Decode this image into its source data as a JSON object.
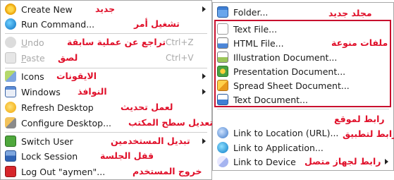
{
  "main_menu": {
    "items": [
      {
        "label": "Create New",
        "annotation": "جديد",
        "icon": "new-star-icon"
      },
      {
        "label": "Run Command...",
        "annotation": "تشغيل أمر",
        "icon": "run-command-icon"
      },
      {
        "label_u": "U",
        "label_rest": "ndo",
        "annotation": "تراجع عن عملية سابقة",
        "shortcut": "Ctrl+Z",
        "icon": "undo-icon"
      },
      {
        "label_u": "P",
        "label_rest": "aste",
        "annotation": "لصق",
        "shortcut": "Ctrl+V",
        "icon": "paste-icon"
      },
      {
        "label": "Icons",
        "annotation": "الايقونات",
        "icon": "icons-icon"
      },
      {
        "label": "Windows",
        "annotation": "النوافذ",
        "icon": "windows-icon"
      },
      {
        "label": "Refresh Desktop",
        "annotation": "لعمل تحديث",
        "icon": "refresh-icon"
      },
      {
        "label": "Configure Desktop...",
        "annotation": "تعديل سطح المكتب",
        "icon": "configure-icon"
      },
      {
        "label": "Switch User",
        "annotation": "تبديل المستخدمين",
        "icon": "switch-user-icon"
      },
      {
        "label": "Lock Session",
        "annotation": "قفل الجلسة",
        "icon": "lock-icon"
      },
      {
        "label": "Log Out \"aymen\"...",
        "annotation": "خروج المستخدم",
        "icon": "logout-icon"
      }
    ]
  },
  "sub_menu": {
    "items": [
      {
        "label": "Folder...",
        "annotation": "مجلد جديد",
        "icon": "folder-icon"
      },
      {
        "label": "Text File...",
        "icon": "text-file-icon"
      },
      {
        "label": "HTML File...",
        "icon": "html-file-icon"
      },
      {
        "label": "Illustration Document...",
        "icon": "illustration-icon"
      },
      {
        "label": "Presentation Document...",
        "icon": "presentation-icon"
      },
      {
        "label": "Spread Sheet Document...",
        "icon": "spreadsheet-icon"
      },
      {
        "label": "Text Document...",
        "icon": "text-document-icon"
      },
      {
        "label": "Link to Location (URL)...",
        "annotation": "رابط لموقع",
        "icon": "link-url-icon"
      },
      {
        "label": "Link to Application...",
        "annotation": "رابط لتطبيق",
        "icon": "link-app-icon"
      },
      {
        "label": "Link to Device",
        "annotation": "رابط لجهاز متصل",
        "icon": "link-device-icon"
      }
    ],
    "group_annotation": "ملفات منوعة"
  },
  "colors": {
    "annotation": "#e0102a",
    "highlight_box": "#c8102e"
  }
}
